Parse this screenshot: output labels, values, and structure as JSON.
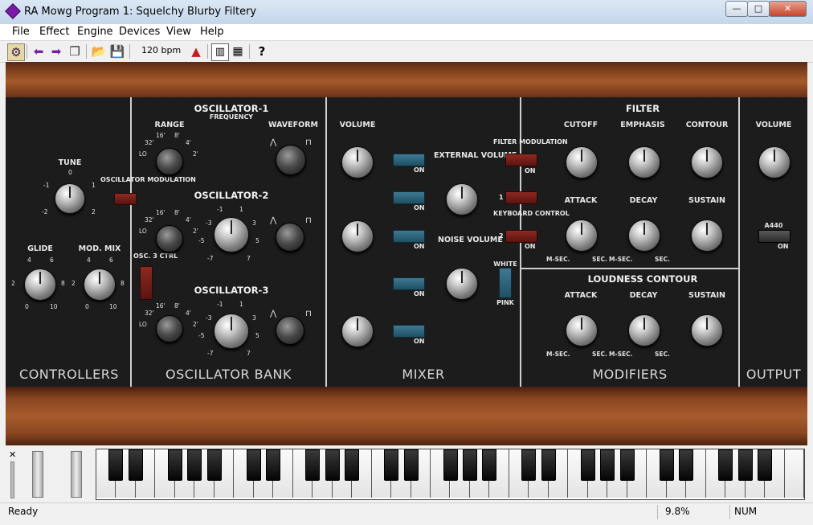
{
  "window": {
    "title": "RA Mowg Program 1: Squelchy Blurby Filtery",
    "min": "—",
    "max": "□",
    "close": "✕"
  },
  "menu": [
    "File",
    "Effect",
    "Engine",
    "Devices",
    "View",
    "Help"
  ],
  "toolbar": {
    "bpm": "120 bpm",
    "help": "?"
  },
  "panel": {
    "sections": {
      "controllers": "CONTROLLERS",
      "oscillator_bank": "OSCILLATOR BANK",
      "mixer": "MIXER",
      "modifiers": "MODIFIERS",
      "output": "OUTPUT"
    },
    "controllers": {
      "tune": "TUNE",
      "tune_ticks": [
        "0",
        "-1",
        "1",
        "-2",
        "2"
      ],
      "osc_mod": "OSCILLATOR MODULATION",
      "glide": "GLIDE",
      "modmix": "MOD. MIX",
      "ticks_0_10": [
        "4",
        "6",
        "2",
        "8",
        "0",
        "10"
      ]
    },
    "osc": {
      "osc1_title": "OSCILLATOR-1",
      "osc1_sub": "FREQUENCY",
      "osc2_title": "OSCILLATOR-2",
      "osc3_title": "OSCILLATOR-3",
      "range": "RANGE",
      "waveform": "WAVEFORM",
      "osc3_ctrl": "OSC. 3 CTRL",
      "range_ticks": [
        "16'",
        "8'",
        "32'",
        "4'",
        "LO",
        "2'"
      ],
      "freq_ticks": [
        "1",
        "-1",
        "3",
        "-3",
        "5",
        "-5",
        "7",
        "-7"
      ]
    },
    "mixer": {
      "volume": "VOLUME",
      "external_volume": "EXTERNAL VOLUME",
      "noise_volume": "NOISE VOLUME",
      "on": "ON",
      "white": "WHITE",
      "pink": "PINK"
    },
    "filter_mod": "FILTER MODULATION",
    "keyboard_control": "KEYBOARD CONTROL",
    "filter_mod_labels": [
      "ON",
      "1",
      "2",
      "ON"
    ],
    "modifiers": {
      "filter": "FILTER",
      "cutoff": "CUTOFF",
      "emphasis": "EMPHASIS",
      "contour": "CONTOUR",
      "attack": "ATTACK",
      "decay": "DECAY",
      "sustain": "SUSTAIN",
      "loudness": "LOUDNESS CONTOUR",
      "msec": "M-SEC.",
      "sec": "SEC.",
      "cutoff_ticks": [
        "0",
        "-2",
        "2",
        "-4",
        "4"
      ],
      "time_ticks": [
        "600",
        "1",
        "0",
        "200",
        "5",
        "10",
        "10"
      ]
    },
    "output": {
      "volume": "VOLUME",
      "a440": "A440",
      "on": "ON"
    }
  },
  "keyboard": {
    "white_keys": 36
  },
  "status": {
    "text": "Ready",
    "cpu": "9.8%",
    "num": "NUM"
  }
}
